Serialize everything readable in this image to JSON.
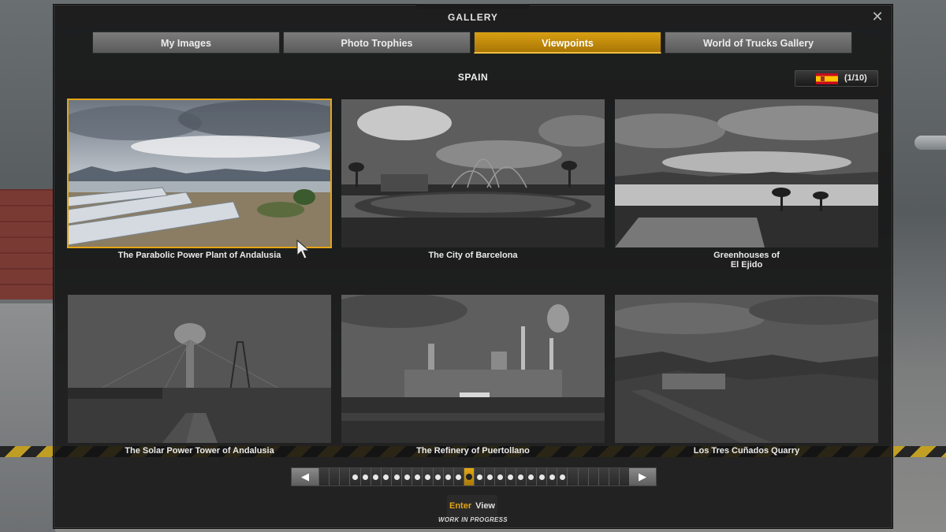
{
  "window": {
    "title": "GALLERY",
    "close_icon": "close-icon"
  },
  "tabs": [
    {
      "label": "My Images",
      "active": false
    },
    {
      "label": "Photo Trophies",
      "active": false
    },
    {
      "label": "Viewpoints",
      "active": true
    },
    {
      "label": "World of Trucks Gallery",
      "active": false
    }
  ],
  "country": {
    "name": "SPAIN",
    "flag_icon": "spain-flag-icon",
    "page": "(1/10)"
  },
  "viewpoints": [
    {
      "caption": "The Parabolic Power Plant of Andalusia",
      "selected": true
    },
    {
      "caption": "The City of Barcelona",
      "selected": false
    },
    {
      "caption": "Greenhouses of\nEl Ejido",
      "selected": false
    },
    {
      "caption": "The Solar Power Tower of Andalusia",
      "selected": false
    },
    {
      "caption": "The Refinery of Puertollano",
      "selected": false
    },
    {
      "caption": "Los Tres Cuñados Quarry",
      "selected": false
    }
  ],
  "pager": {
    "total": 30,
    "current": 14,
    "prev_icon": "triangle-left-icon",
    "next_icon": "triangle-right-icon"
  },
  "footer": {
    "key": "Enter",
    "action": "View",
    "status": "WORK IN PROGRESS"
  },
  "colors": {
    "accent": "#e5a514",
    "panel": "#121212"
  }
}
